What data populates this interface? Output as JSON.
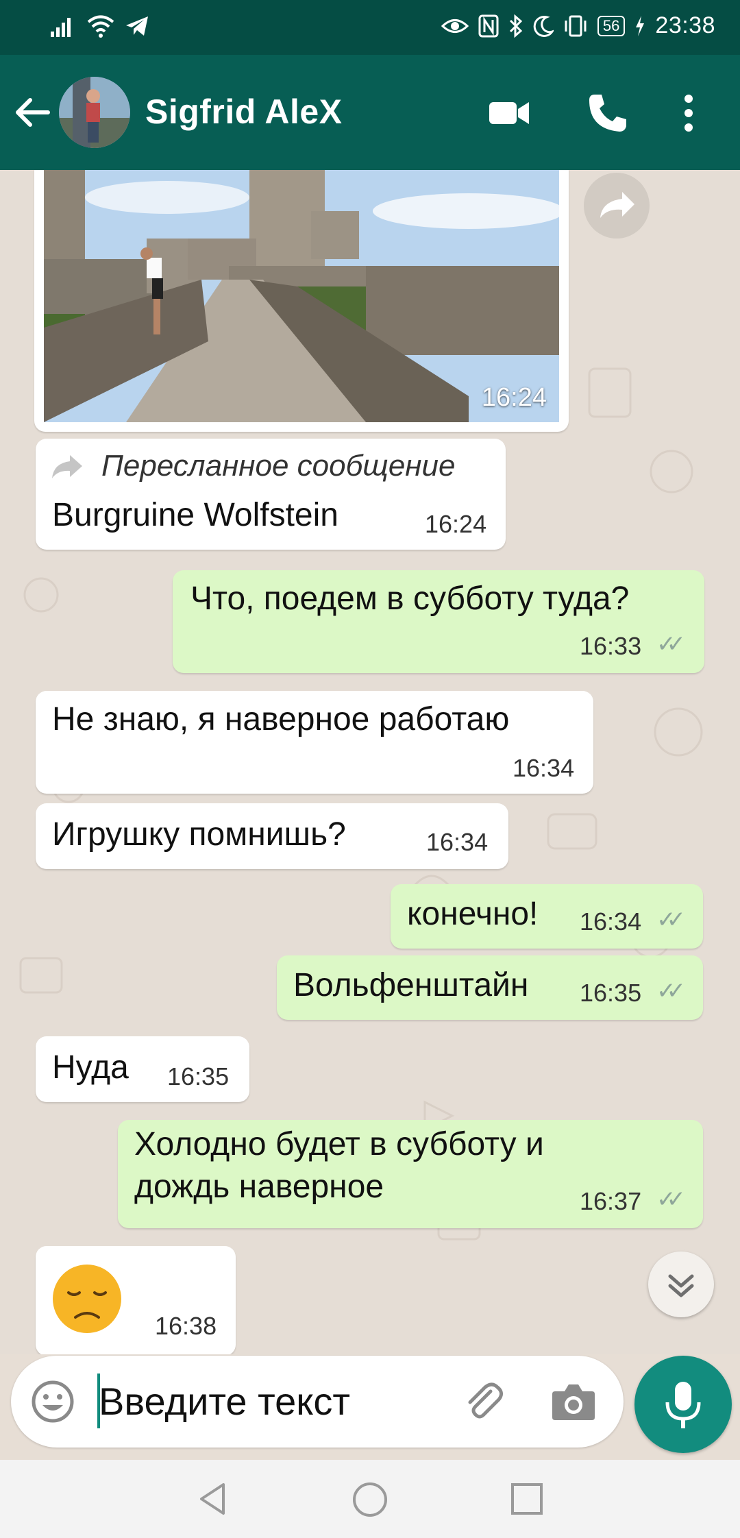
{
  "status_bar": {
    "time": "23:38",
    "battery": "56",
    "icons": [
      "signal-icon",
      "wifi-icon",
      "telegram-icon",
      "eye-icon",
      "nfc-icon",
      "bluetooth-icon",
      "moon-icon",
      "vibrate-icon",
      "battery-icon",
      "charging-icon"
    ]
  },
  "header": {
    "contact_name": "Sigfrid AleX",
    "icons": [
      "back-arrow-icon",
      "video-call-icon",
      "phone-icon",
      "more-vert-icon"
    ]
  },
  "messages": [
    {
      "direction": "in",
      "type": "image",
      "time": "16:24"
    },
    {
      "direction": "in",
      "type": "text",
      "forwarded_label": "Пересланное сообщение",
      "text": "Burgruine Wolfstein",
      "time": "16:24"
    },
    {
      "direction": "out",
      "type": "text",
      "text": "Что, поедем в субботу туда?",
      "time": "16:33",
      "status": "read"
    },
    {
      "direction": "in",
      "type": "text",
      "text": "Не знаю, я наверное работаю",
      "time": "16:34"
    },
    {
      "direction": "in",
      "type": "text",
      "text": "Игрушку помнишь?",
      "time": "16:34"
    },
    {
      "direction": "out",
      "type": "text",
      "text": "конечно!",
      "time": "16:34",
      "status": "read"
    },
    {
      "direction": "out",
      "type": "text",
      "text": "Вольфенштайн",
      "time": "16:35",
      "status": "read"
    },
    {
      "direction": "in",
      "type": "text",
      "text": "Нуда",
      "time": "16:35"
    },
    {
      "direction": "out",
      "type": "text",
      "text_line1": "Холодно будет в субботу и",
      "text_line2": "дождь наверное",
      "time": "16:37",
      "status": "read"
    },
    {
      "direction": "in",
      "type": "emoji",
      "text": "😞",
      "time": "16:38"
    }
  ],
  "input": {
    "placeholder": "Введите текст",
    "icons": [
      "emoji-icon",
      "attach-icon",
      "camera-icon",
      "mic-icon"
    ]
  },
  "colors": {
    "header": "#075e54",
    "status_bar": "#054d44",
    "outgoing_bubble": "#dcf8c6",
    "incoming_bubble": "#ffffff",
    "accent": "#128c7e",
    "chat_bg": "#e5ddd5"
  }
}
